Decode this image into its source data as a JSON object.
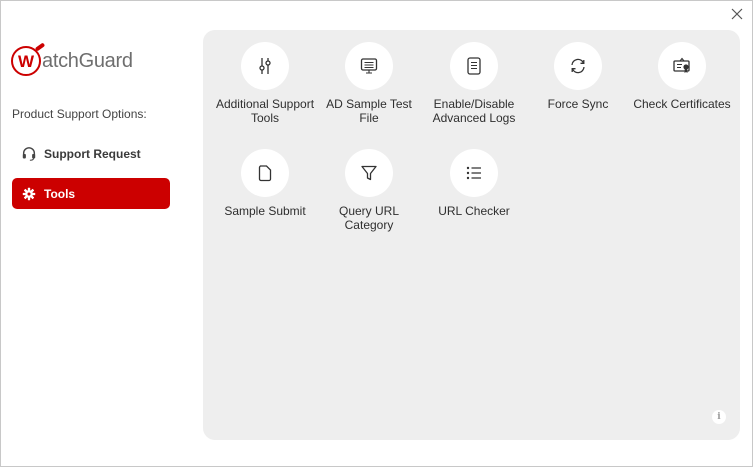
{
  "window": {
    "close_label": "×"
  },
  "logo": {
    "text": "atchGuard"
  },
  "sidebar": {
    "heading": "Product Support Options:",
    "items": [
      {
        "label": "Support Request",
        "icon": "headset-icon",
        "active": false
      },
      {
        "label": "Tools",
        "icon": "gear-icon",
        "active": true
      }
    ]
  },
  "tools": [
    {
      "label": "Additional Support Tools",
      "icon": "sliders-icon"
    },
    {
      "label": "AD Sample Test File",
      "icon": "monitor-icon"
    },
    {
      "label": "Enable/Disable Advanced Logs",
      "icon": "document-icon"
    },
    {
      "label": "Force Sync",
      "icon": "sync-icon"
    },
    {
      "label": "Check Certificates",
      "icon": "certificate-icon"
    },
    {
      "label": "Sample Submit",
      "icon": "file-icon"
    },
    {
      "label": "Query URL Category",
      "icon": "filter-icon"
    },
    {
      "label": "URL Checker",
      "icon": "list-icon"
    }
  ],
  "info": {
    "label": "i"
  },
  "colors": {
    "accent": "#cc0000",
    "panel": "#eeeeee"
  }
}
